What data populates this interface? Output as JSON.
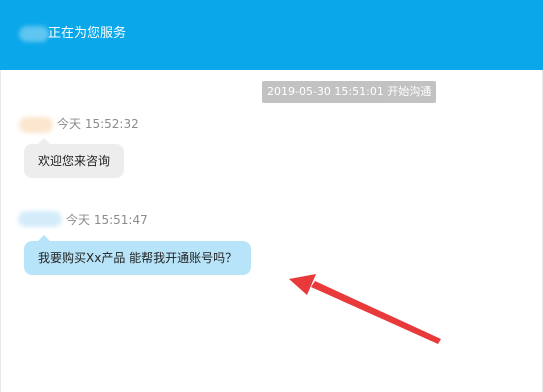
{
  "header": {
    "title": "正在为您服务"
  },
  "system_notice": {
    "text": "2019-05-30 15:51:01 开始沟通"
  },
  "messages": [
    {
      "role": "agent",
      "time": "今天 15:52:32",
      "text": "欢迎您来咨询"
    },
    {
      "role": "user",
      "time": "今天 15:51:47",
      "text": "我要购买Xx产品 能帮我开通账号吗？"
    }
  ],
  "colors": {
    "header_bg": "#0aa7ea",
    "agent_bubble": "#ededed",
    "user_bubble": "#b7e4f8",
    "annotation_arrow": "#e8393b"
  },
  "icons": {
    "annotation": "red-arrow-icon"
  }
}
